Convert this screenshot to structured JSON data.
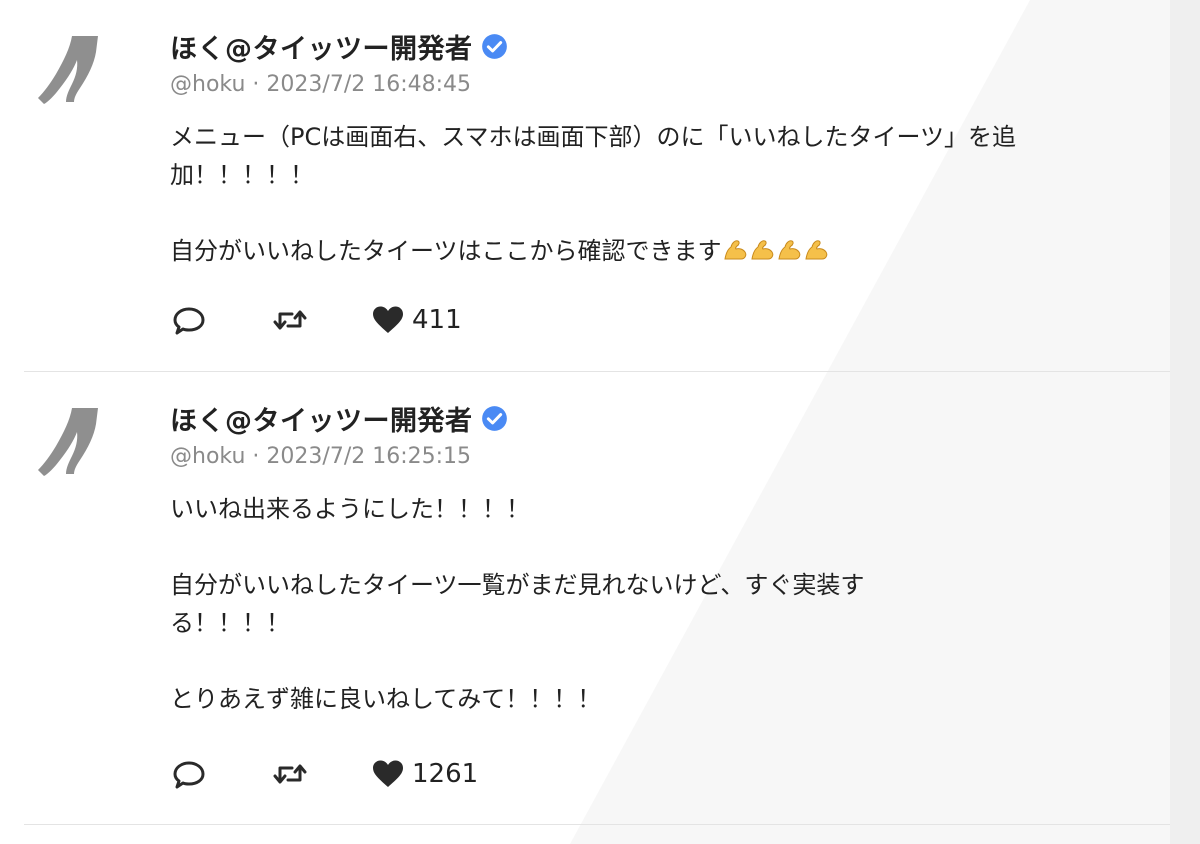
{
  "posts": [
    {
      "author": {
        "name": "ほく@タイッツー開発者",
        "verified": true,
        "avatar_icon": "tights-icon"
      },
      "handle": "@hoku",
      "separator": "·",
      "timestamp": "2023/7/2 16:48:45",
      "paragraphs": [
        "メニュー（PCは画面右、スマホは画面下部）のに「いいねしたタイーツ」を追加！！！！！",
        "自分がいいねしたタイーツはここから確認できます"
      ],
      "emoji": [
        "flexed-biceps",
        "flexed-biceps",
        "flexed-biceps",
        "flexed-biceps"
      ],
      "like_count": "411"
    },
    {
      "author": {
        "name": "ほく@タイッツー開発者",
        "verified": true,
        "avatar_icon": "tights-icon"
      },
      "handle": "@hoku",
      "separator": "·",
      "timestamp": "2023/7/2 16:25:15",
      "paragraphs": [
        "いいね出来るようにした！！！！",
        "自分がいいねしたタイーツ一覧がまだ見れないけど、すぐ実装する！！！！",
        "とりあえず雑に良いねしてみて！！！！"
      ],
      "like_count": "1261"
    }
  ],
  "colors": {
    "verified": "#4a8af4",
    "meta_text": "#8a8a8a",
    "divider": "#e4e4e4",
    "emoji": "#f5c04a"
  }
}
